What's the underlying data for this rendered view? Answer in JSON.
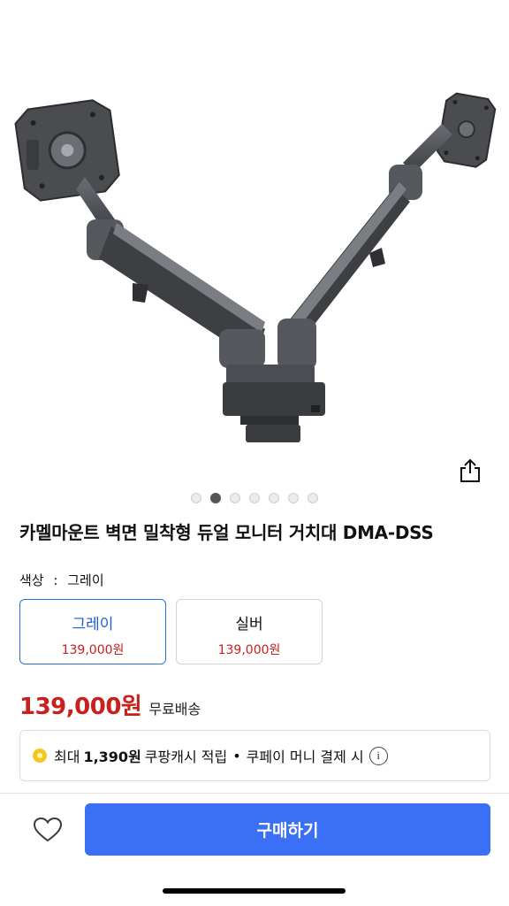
{
  "product": {
    "title": "카멜마운트 벽면 밀착형 듀얼 모니터 거치대 DMA-DSS",
    "image_icon": "dual-monitor-arm-image",
    "gallery": {
      "count": 7,
      "active_index": 1
    }
  },
  "share": {
    "icon": "share-icon"
  },
  "options": {
    "label": "색상",
    "separator": ":",
    "selected_value": "그레이",
    "items": [
      {
        "name": "그레이",
        "price": "139,000원",
        "selected": true
      },
      {
        "name": "실버",
        "price": "139,000원",
        "selected": false
      }
    ]
  },
  "pricing": {
    "price": "139,000원",
    "shipping": "무료배송",
    "price_color": "#c8201d"
  },
  "cash": {
    "icon": "coin-icon",
    "prefix": "최대",
    "amount": "1,390원",
    "suffix": "쿠팡캐시 적립",
    "bullet": "•",
    "condition": "쿠페이 머니 결제 시",
    "info_icon": "info-icon"
  },
  "bottom_bar": {
    "wishlist_icon": "heart-icon",
    "buy_label": "구매하기",
    "buy_color": "#3b6ff5"
  }
}
